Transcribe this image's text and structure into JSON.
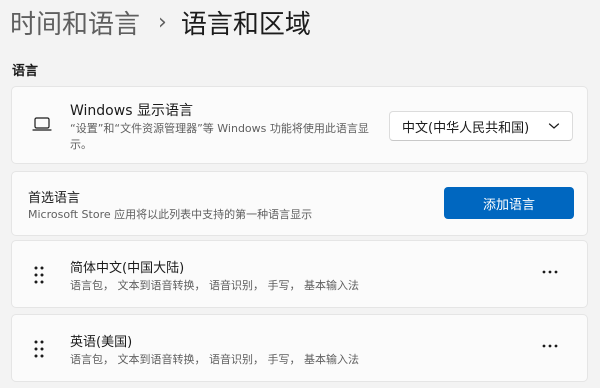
{
  "breadcrumb": {
    "parent": "时间和语言",
    "separator": "›",
    "current": "语言和区域"
  },
  "section_label": "语言",
  "display_language": {
    "title": "Windows 显示语言",
    "description": "“设置”和“文件资源管理器”等 Windows 功能将使用此语言显示。",
    "icon": "laptop-icon",
    "dropdown_value": "中文(中华人民共和国)"
  },
  "preferred_languages": {
    "title": "首选语言",
    "description": "Microsoft Store 应用将以此列表中支持的第一种语言显示",
    "add_button": "添加语言"
  },
  "languages": [
    {
      "name": "简体中文(中国大陆)",
      "features": "语言包， 文本到语音转换， 语音识别， 手写， 基本输入法"
    },
    {
      "name": "英语(美国)",
      "features": "语言包， 文本到语音转换， 语音识别， 手写， 基本输入法"
    }
  ],
  "colors": {
    "accent": "#0067c0",
    "background": "#f3f3f3",
    "card": "#fbfbfb"
  }
}
